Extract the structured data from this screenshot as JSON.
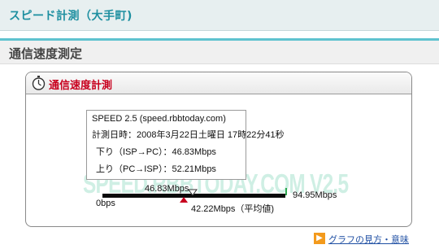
{
  "top_header": {
    "title": "スピード計測（大手町)"
  },
  "section": {
    "title": "通信速度測定"
  },
  "panel": {
    "title": "通信速度計測"
  },
  "result": {
    "version_line": "SPEED 2.5 (speed.rbbtoday.com)",
    "datetime_line": "計測日時：2008年3月22日土曜日 17時22分41秒",
    "down_line": "下り（ISP→PC）：46.83Mbps",
    "up_line": "上り（PC→ISP）：52.21Mbps"
  },
  "watermark": "SPEED.RBBTODAY.COM V2.5",
  "gauge": {
    "current_label": "46.83Mbps",
    "min_label": "0bps",
    "max_label": "94.95Mbps",
    "avg_label": "42.22Mbps（平均値)",
    "current_value": 46.83,
    "avg_value": 42.22,
    "max_value": 94.95
  },
  "help_link": {
    "label": "グラフの見方・意味"
  },
  "colors": {
    "accent": "#1d8fa0",
    "panel_title": "#c8001e",
    "link": "#1f4fa3"
  }
}
